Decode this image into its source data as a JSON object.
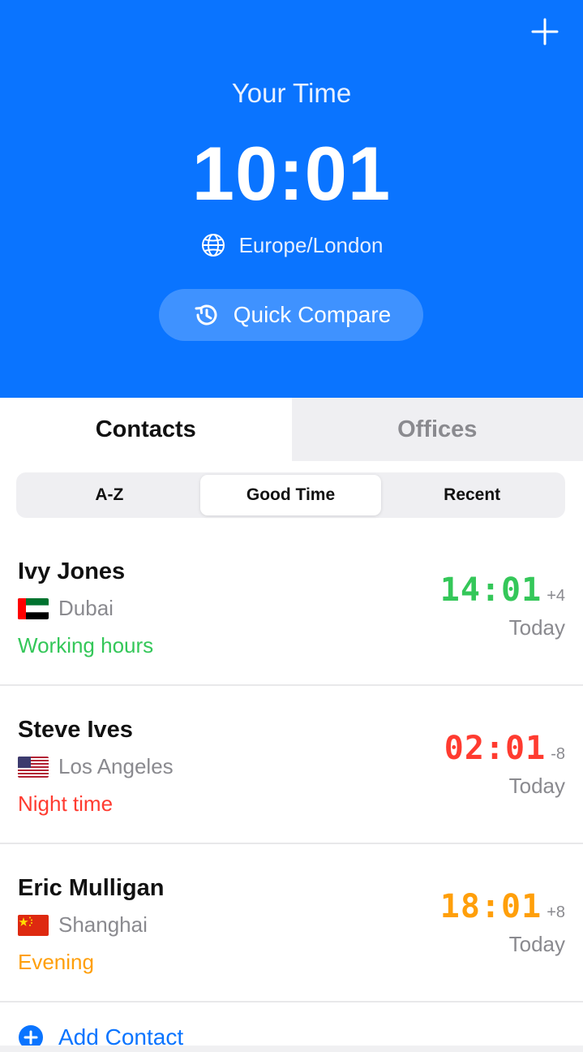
{
  "header": {
    "title": "Your Time",
    "time": "10:01",
    "timezone": "Europe/London",
    "compare_label": "Quick Compare",
    "background_color": "#0A74FF"
  },
  "tabs": [
    {
      "label": "Contacts",
      "active": true
    },
    {
      "label": "Offices",
      "active": false
    }
  ],
  "sort_segments": [
    {
      "label": "A-Z",
      "selected": false
    },
    {
      "label": "Good Time",
      "selected": true
    },
    {
      "label": "Recent",
      "selected": false
    }
  ],
  "contacts": [
    {
      "name": "Ivy Jones",
      "city": "Dubai",
      "flag": "ae-flag-icon",
      "status": "Working hours",
      "status_color": "#34C759",
      "time": "14:01",
      "offset": "+4",
      "day": "Today"
    },
    {
      "name": "Steve Ives",
      "city": "Los Angeles",
      "flag": "us-flag-icon",
      "status": "Night time",
      "status_color": "#FF3B30",
      "time": "02:01",
      "offset": "-8",
      "day": "Today"
    },
    {
      "name": "Eric Mulligan",
      "city": "Shanghai",
      "flag": "cn-flag-icon",
      "status": "Evening",
      "status_color": "#FF9F0A",
      "time": "18:01",
      "offset": "+8",
      "day": "Today"
    }
  ],
  "add_contact_label": "Add Contact",
  "icons": [
    "plus-icon",
    "globe-icon",
    "history-icon",
    "add-circle-icon"
  ]
}
